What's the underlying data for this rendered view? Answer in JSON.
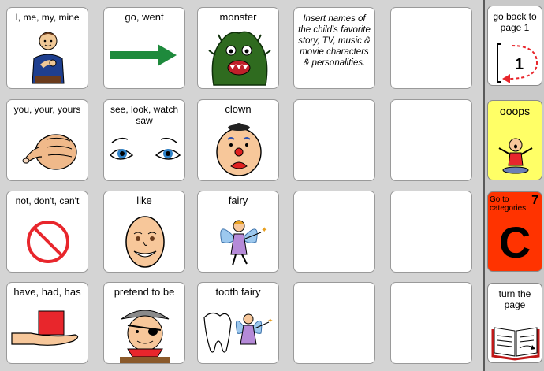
{
  "colors": {
    "board_bg": "#d4d4d4",
    "sidebar_bg": "#c9c9c9",
    "ooops_bg": "#ffff66",
    "categories_bg": "#ff3300",
    "arrow_green": "#1e8a3c",
    "no_red": "#e8262c"
  },
  "grid": {
    "row1": {
      "c1": {
        "label": "I, me, my, mine",
        "icon": "pointing-to-self-person-icon"
      },
      "c2": {
        "label": "go, went",
        "icon": "green-arrow-right-icon"
      },
      "c3": {
        "label": "monster",
        "icon": "green-monster-icon"
      },
      "c4": {
        "note": "Insert names of  the child's favorite story, TV, music & movie characters & personalities."
      },
      "c5": {
        "label": ""
      }
    },
    "row2": {
      "c1": {
        "label": "you, your, yours",
        "icon": "pointing-finger-icon"
      },
      "c2": {
        "label": "see, look, watch saw",
        "icon": "eyes-icon"
      },
      "c3": {
        "label": "clown",
        "icon": "clown-face-icon"
      },
      "c4": {
        "label": ""
      },
      "c5": {
        "label": ""
      }
    },
    "row3": {
      "c1": {
        "label": "not, don't, can't",
        "icon": "no-symbol-icon"
      },
      "c2": {
        "label": "like",
        "icon": "smiling-face-icon"
      },
      "c3": {
        "label": "fairy",
        "icon": "fairy-icon"
      },
      "c4": {
        "label": ""
      },
      "c5": {
        "label": ""
      }
    },
    "row4": {
      "c1": {
        "label": "have, had, has",
        "icon": "hand-holding-box-icon"
      },
      "c2": {
        "label": "pretend to be",
        "icon": "pirate-face-icon"
      },
      "c3": {
        "label": "tooth fairy",
        "icon": "tooth-fairy-icon"
      },
      "c4": {
        "label": ""
      },
      "c5": {
        "label": ""
      }
    }
  },
  "sidebar": {
    "back": {
      "label": "go back to page 1",
      "badge": "1",
      "icon": "return-arrow-page-1-icon"
    },
    "ooops": {
      "label": "ooops",
      "icon": "ooops-child-icon"
    },
    "categories": {
      "label": "Go to categories",
      "number": "7",
      "letter": "C"
    },
    "turn": {
      "label": "turn the page",
      "icon": "open-book-icon"
    }
  }
}
